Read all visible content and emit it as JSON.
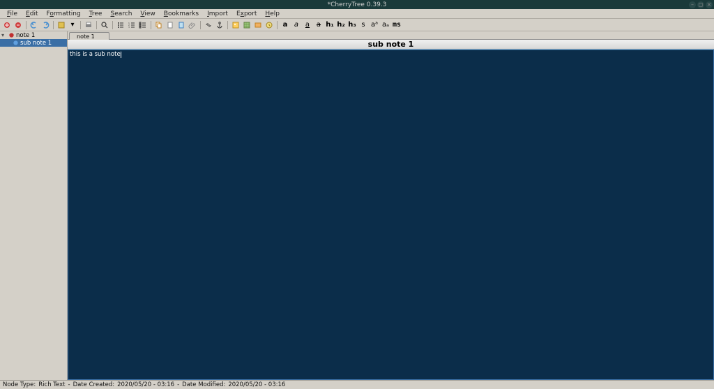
{
  "titlebar": {
    "title": "*CherryTree 0.39.3"
  },
  "menu": {
    "file": "File",
    "edit": "Edit",
    "formatting": "Formatting",
    "tree": "Tree",
    "search": "Search",
    "view": "View",
    "bookmarks": "Bookmarks",
    "import": "Import",
    "export": "Export",
    "help": "Help"
  },
  "toolbar_labels": {
    "bold": "a",
    "italic": "a",
    "underline": "a",
    "strike": "a",
    "h1": "h₁",
    "h2": "h₂",
    "h3": "h₃",
    "small": "s",
    "sup": "aᵃ",
    "sub": "aₐ",
    "mono": "ms"
  },
  "tree": {
    "root": {
      "label": "note 1"
    },
    "child": {
      "label": "sub note 1"
    }
  },
  "tab": {
    "label": "note 1"
  },
  "node_header": "sub note 1",
  "editor": {
    "content": "this is a sub note"
  },
  "status": {
    "node_type_label": "Node Type:",
    "node_type_value": "Rich Text",
    "sep": "  -  ",
    "created_label": "Date Created:",
    "created_value": "2020/05/20 - 03:16",
    "modified_label": "Date Modified:",
    "modified_value": "2020/05/20 - 03:16"
  }
}
